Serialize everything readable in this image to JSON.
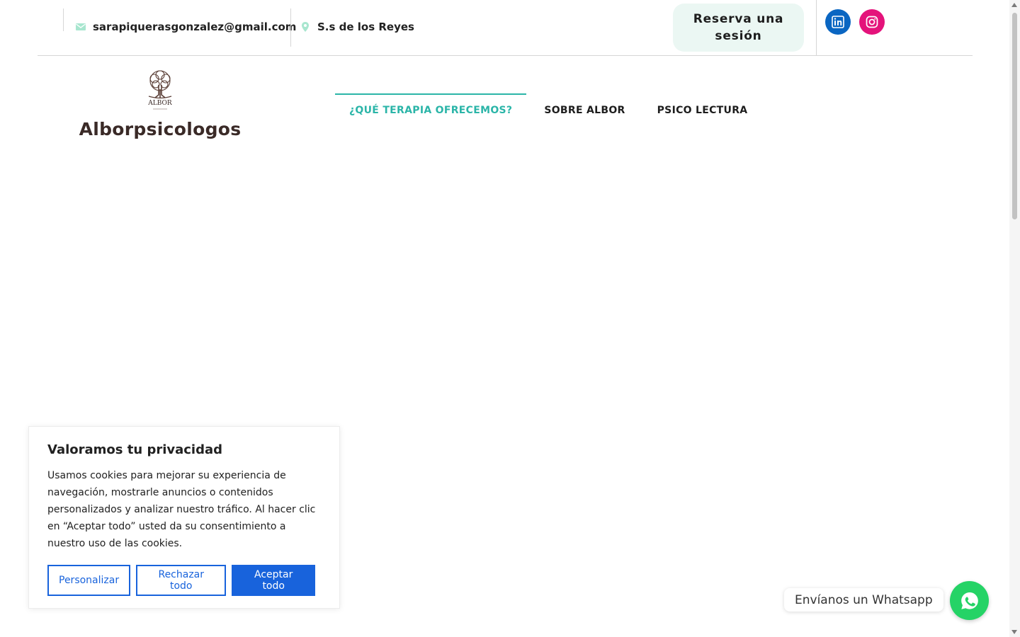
{
  "topbar": {
    "email": "sarapiquerasgonzalez@gmail.com",
    "location": "S.s de los Reyes",
    "reserve_label": "Reserva una sesión",
    "email_icon": "envelope-icon",
    "location_icon": "map-pin-icon",
    "social": [
      {
        "name": "linkedin-icon",
        "color": "#0a66c2"
      },
      {
        "name": "instagram-icon",
        "color": "#e4137b"
      }
    ]
  },
  "header": {
    "logo_text": "ALBOR",
    "site_title": "Alborpsicologos"
  },
  "nav": {
    "items": [
      {
        "label": "¿QUÉ TERAPIA OFRECEMOS?",
        "active": true
      },
      {
        "label": "SOBRE ALBOR",
        "active": false
      },
      {
        "label": "PSICO LECTURA",
        "active": false
      }
    ]
  },
  "cookie": {
    "title": "Valoramos tu privacidad",
    "text": "Usamos cookies para mejorar su experiencia de navegación, mostrarle anuncios o contenidos personalizados y analizar nuestro tráfico. Al hacer clic en “Aceptar todo” usted da su consentimiento a nuestro uso de las cookies.",
    "customize_label": "Personalizar",
    "reject_label": "Rechazar todo",
    "accept_label": "Aceptar todo"
  },
  "whatsapp": {
    "label": "Envíanos un Whatsapp",
    "icon": "whatsapp-icon"
  },
  "colors": {
    "accent": "#2bb5a8",
    "reserve_bg": "#ebf7f3",
    "cookie_blue": "#1863dc",
    "whatsapp_green": "#25d366"
  }
}
